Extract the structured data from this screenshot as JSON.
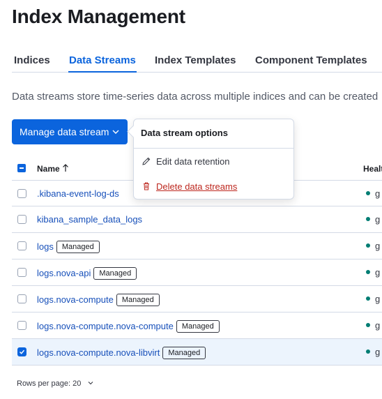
{
  "page": {
    "title": "Index Management"
  },
  "tabs": [
    {
      "label": "Indices"
    },
    {
      "label": "Data Streams"
    },
    {
      "label": "Index Templates"
    },
    {
      "label": "Component Templates"
    }
  ],
  "active_tab": "Data Streams",
  "description": "Data streams store time-series data across multiple indices and can be created",
  "manage_button": {
    "label": "Manage data stream",
    "icon": "chevron-down-icon"
  },
  "popover": {
    "title": "Data stream options",
    "items": [
      {
        "label": "Edit data retention",
        "icon": "pencil-icon"
      },
      {
        "label": "Delete data streams",
        "icon": "trash-icon",
        "color": "#bd271e"
      }
    ]
  },
  "table": {
    "columns": {
      "name": "Name",
      "health": "Healt",
      "sort": "ascending"
    },
    "rows": [
      {
        "name": ".kibana-event-log-ds",
        "badge": "",
        "health": "g",
        "selected": false
      },
      {
        "name": "kibana_sample_data_logs",
        "badge": "",
        "health": "g",
        "selected": false
      },
      {
        "name": "logs",
        "badge": "Managed",
        "health": "g",
        "selected": false
      },
      {
        "name": "logs.nova-api",
        "badge": "Managed",
        "health": "g",
        "selected": false
      },
      {
        "name": "logs.nova-compute",
        "badge": "Managed",
        "health": "g",
        "selected": false
      },
      {
        "name": "logs.nova-compute.nova-compute",
        "badge": "Managed",
        "health": "g",
        "selected": false
      },
      {
        "name": "logs.nova-compute.nova-libvirt",
        "badge": "Managed",
        "health": "g",
        "selected": true
      }
    ]
  },
  "pagination": {
    "label": "Rows per page: 20"
  },
  "colors": {
    "primary": "#0b64dd",
    "link": "#1750ba",
    "danger": "#bd271e",
    "healthy": "#017d73"
  }
}
